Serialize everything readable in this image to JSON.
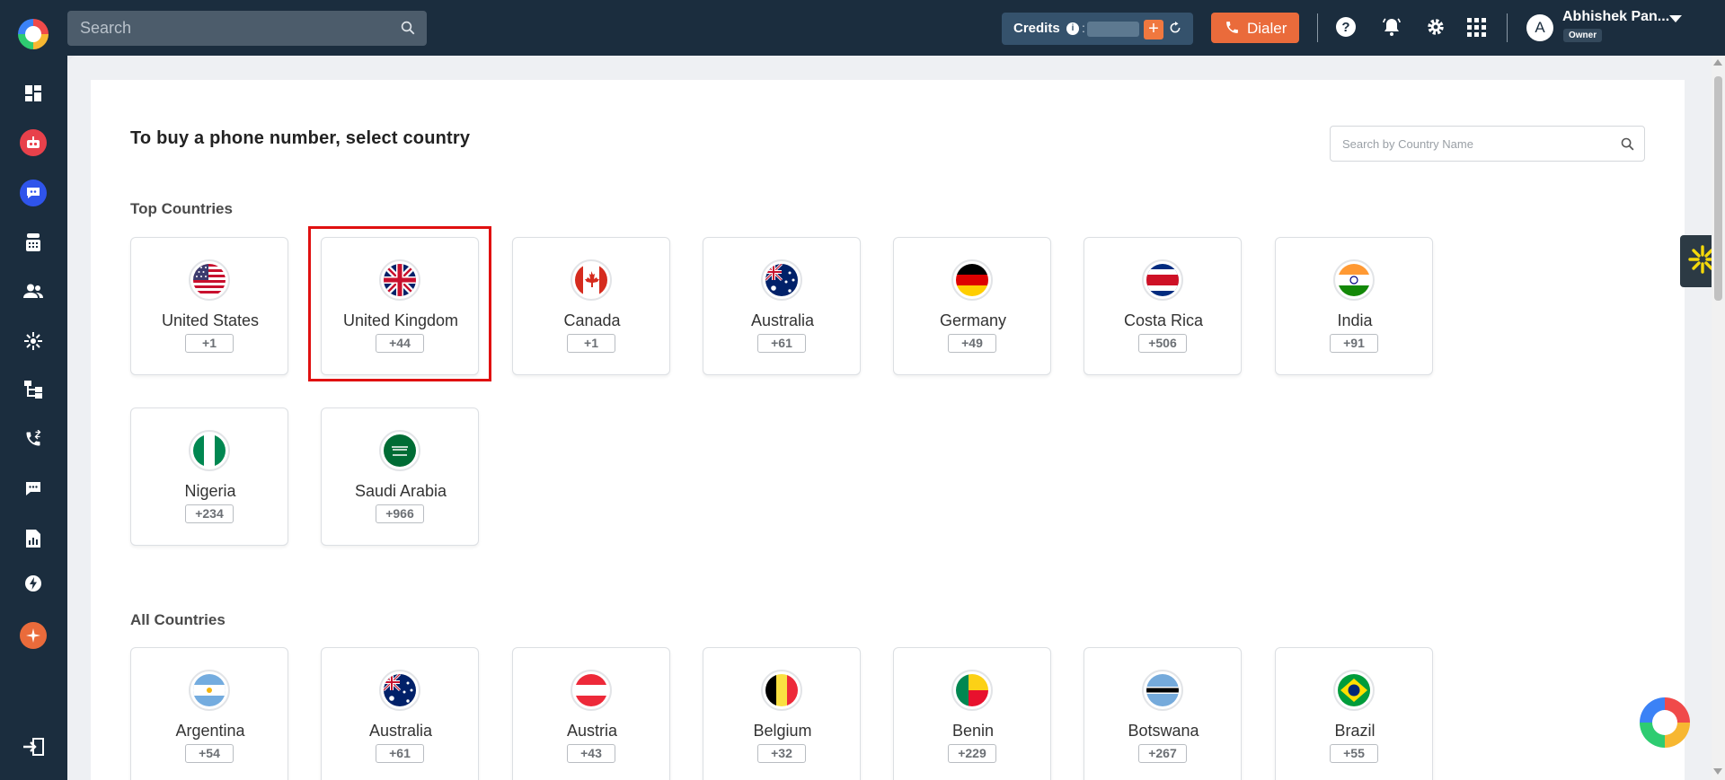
{
  "topbar": {
    "search_placeholder": "Search",
    "credits_label": "Credits",
    "credits_info": "i",
    "credits_colon": ":",
    "credits_add": "+",
    "dialer_label": "Dialer",
    "user_initial": "A",
    "user_name": "Abhishek Pan...",
    "user_role": "Owner"
  },
  "sidebar": {
    "items": [
      "dashboard-icon",
      "bot-icon",
      "chat-bot-icon",
      "phone-system-icon",
      "contacts-icon",
      "integrations-icon",
      "workflow-icon",
      "call-logs-icon",
      "messages-icon",
      "reports-icon",
      "power-icon",
      "ai-sparkle-icon",
      "logout-icon"
    ]
  },
  "page": {
    "title": "To buy a phone number, select country",
    "country_search_placeholder": "Search by Country Name",
    "top_section": "Top Countries",
    "all_section": "All Countries"
  },
  "top_countries": [
    {
      "name": "United States",
      "code": "+1"
    },
    {
      "name": "United Kingdom",
      "code": "+44"
    },
    {
      "name": "Canada",
      "code": "+1"
    },
    {
      "name": "Australia",
      "code": "+61"
    },
    {
      "name": "Germany",
      "code": "+49"
    },
    {
      "name": "Costa Rica",
      "code": "+506"
    },
    {
      "name": "India",
      "code": "+91"
    },
    {
      "name": "Nigeria",
      "code": "+234"
    },
    {
      "name": "Saudi Arabia",
      "code": "+966"
    }
  ],
  "all_countries": [
    {
      "name": "Argentina",
      "code": "+54"
    },
    {
      "name": "Australia",
      "code": "+61"
    },
    {
      "name": "Austria",
      "code": "+43"
    },
    {
      "name": "Belgium",
      "code": "+32"
    },
    {
      "name": "Benin",
      "code": "+229"
    },
    {
      "name": "Botswana",
      "code": "+267"
    },
    {
      "name": "Brazil",
      "code": "+55"
    }
  ],
  "colors": {
    "topbar": "#1b2d3e",
    "accent": "#ea6b3b",
    "highlight": "#e01010"
  }
}
